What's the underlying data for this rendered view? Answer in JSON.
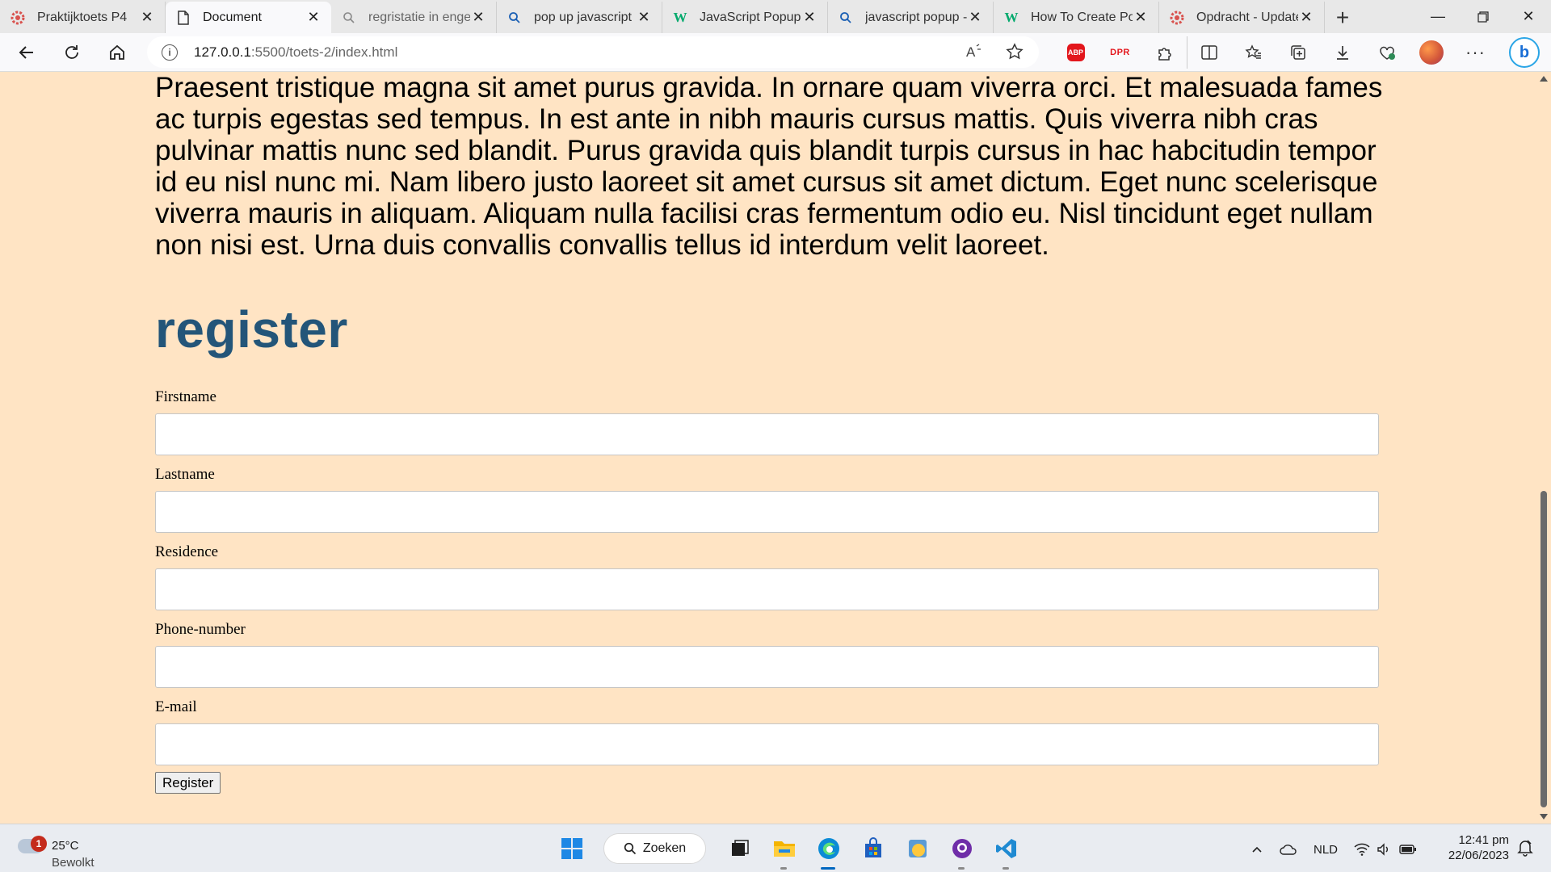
{
  "browser": {
    "tabs": [
      {
        "label": "Praktijktoets P4",
        "icon": "red-gear-favicon"
      },
      {
        "label": "Document",
        "icon": "document-favicon",
        "active": true
      },
      {
        "label": "regristatie in engels",
        "icon": "search-favicon"
      },
      {
        "label": "pop up javascript -",
        "icon": "search-favicon"
      },
      {
        "label": "JavaScript Popup B",
        "icon": "w3-favicon"
      },
      {
        "label": "javascript popup -",
        "icon": "search-favicon"
      },
      {
        "label": "How To Create Pop",
        "icon": "w3-favicon"
      },
      {
        "label": "Opdracht - Update",
        "icon": "red-gear-favicon"
      }
    ],
    "address": {
      "host": "127.0.0.1",
      "path": ":5500/toets-2/index.html"
    },
    "extensions": {
      "abp": "ABP",
      "dpr": "DPR"
    }
  },
  "page": {
    "paragraph": "Praesent tristique magna sit amet purus gravida. In ornare quam viverra orci. Et malesuada fames ac turpis egestas sed tempus. In est ante in nibh mauris cursus mattis. Quis viverra nibh cras pulvinar mattis nunc sed blandit. Purus gravida quis blandit turpis cursus in hac habcitudin tempor id eu nisl nunc mi. Nam libero justo laoreet sit amet cursus sit amet dictum. Eget nunc scelerisque viverra mauris in aliquam. Aliquam nulla facilisi cras fermentum odio eu. Nisl tincidunt eget nullam non nisi est. Urna duis convallis convallis tellus id interdum velit laoreet.",
    "form_title": "register",
    "fields": [
      {
        "label": "Firstname",
        "value": ""
      },
      {
        "label": "Lastname",
        "value": ""
      },
      {
        "label": "Residence",
        "value": ""
      },
      {
        "label": "Phone-number",
        "value": ""
      },
      {
        "label": "E-mail",
        "value": ""
      }
    ],
    "submit_label": "Register"
  },
  "taskbar": {
    "weather": {
      "temp": "25°C",
      "condition": "Bewolkt",
      "badge": "1"
    },
    "search_label": "Zoeken",
    "language": "NLD",
    "time": "12:41 pm",
    "date": "22/06/2023"
  },
  "colors": {
    "page_background": "#ffe4c4",
    "heading": "#235579",
    "taskbar_accent": "#0067c0"
  }
}
